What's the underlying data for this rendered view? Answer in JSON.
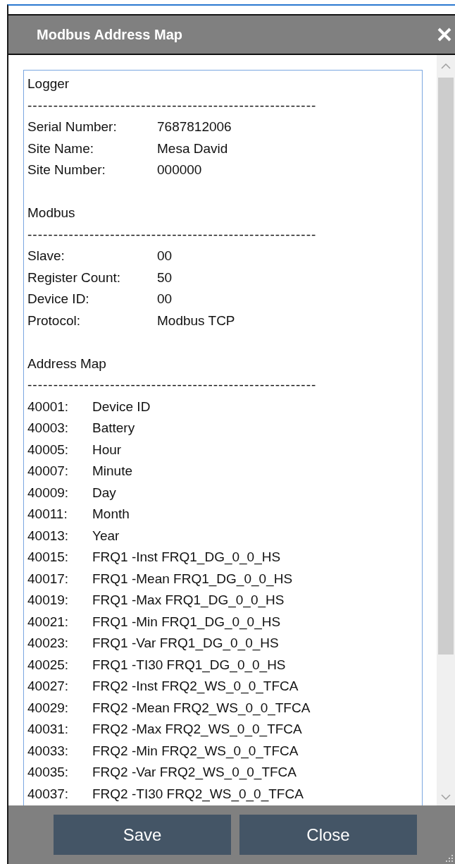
{
  "window": {
    "title": "Modbus Address Map"
  },
  "sections": [
    {
      "title": "Logger",
      "divider": "--------------------------------------------------------",
      "fields": [
        {
          "label": "Serial Number:",
          "value": "7687812006"
        },
        {
          "label": "Site Name:",
          "value": "Mesa David"
        },
        {
          "label": "Site Number:",
          "value": "000000"
        }
      ]
    },
    {
      "title": "Modbus",
      "divider": "--------------------------------------------------------",
      "fields": [
        {
          "label": "Slave:",
          "value": "00"
        },
        {
          "label": "Register Count:",
          "value": "50"
        },
        {
          "label": "Device ID:",
          "value": "00"
        },
        {
          "label": "Protocol:",
          "value": "Modbus TCP"
        }
      ]
    }
  ],
  "address_map": {
    "title": "Address Map",
    "divider": "--------------------------------------------------------",
    "entries": [
      {
        "address": "40001:",
        "name": "Device ID"
      },
      {
        "address": "40003:",
        "name": "Battery"
      },
      {
        "address": "40005:",
        "name": "Hour"
      },
      {
        "address": "40007:",
        "name": "Minute"
      },
      {
        "address": "40009:",
        "name": "Day"
      },
      {
        "address": "40011:",
        "name": "Month"
      },
      {
        "address": "40013:",
        "name": "Year"
      },
      {
        "address": "40015:",
        "name": "FRQ1 -Inst FRQ1_DG_0_0_HS"
      },
      {
        "address": "40017:",
        "name": "FRQ1 -Mean FRQ1_DG_0_0_HS"
      },
      {
        "address": "40019:",
        "name": "FRQ1 -Max FRQ1_DG_0_0_HS"
      },
      {
        "address": "40021:",
        "name": "FRQ1 -Min FRQ1_DG_0_0_HS"
      },
      {
        "address": "40023:",
        "name": "FRQ1 -Var FRQ1_DG_0_0_HS"
      },
      {
        "address": "40025:",
        "name": "FRQ1 -TI30 FRQ1_DG_0_0_HS"
      },
      {
        "address": "40027:",
        "name": "FRQ2 -Inst FRQ2_WS_0_0_TFCA"
      },
      {
        "address": "40029:",
        "name": "FRQ2 -Mean FRQ2_WS_0_0_TFCA"
      },
      {
        "address": "40031:",
        "name": "FRQ2 -Max FRQ2_WS_0_0_TFCA"
      },
      {
        "address": "40033:",
        "name": "FRQ2 -Min FRQ2_WS_0_0_TFCA"
      },
      {
        "address": "40035:",
        "name": "FRQ2 -Var FRQ2_WS_0_0_TFCA"
      },
      {
        "address": "40037:",
        "name": "FRQ2 -TI30 FRQ2_WS_0_0_TFCA"
      }
    ]
  },
  "buttons": [
    "Save",
    "Close"
  ]
}
